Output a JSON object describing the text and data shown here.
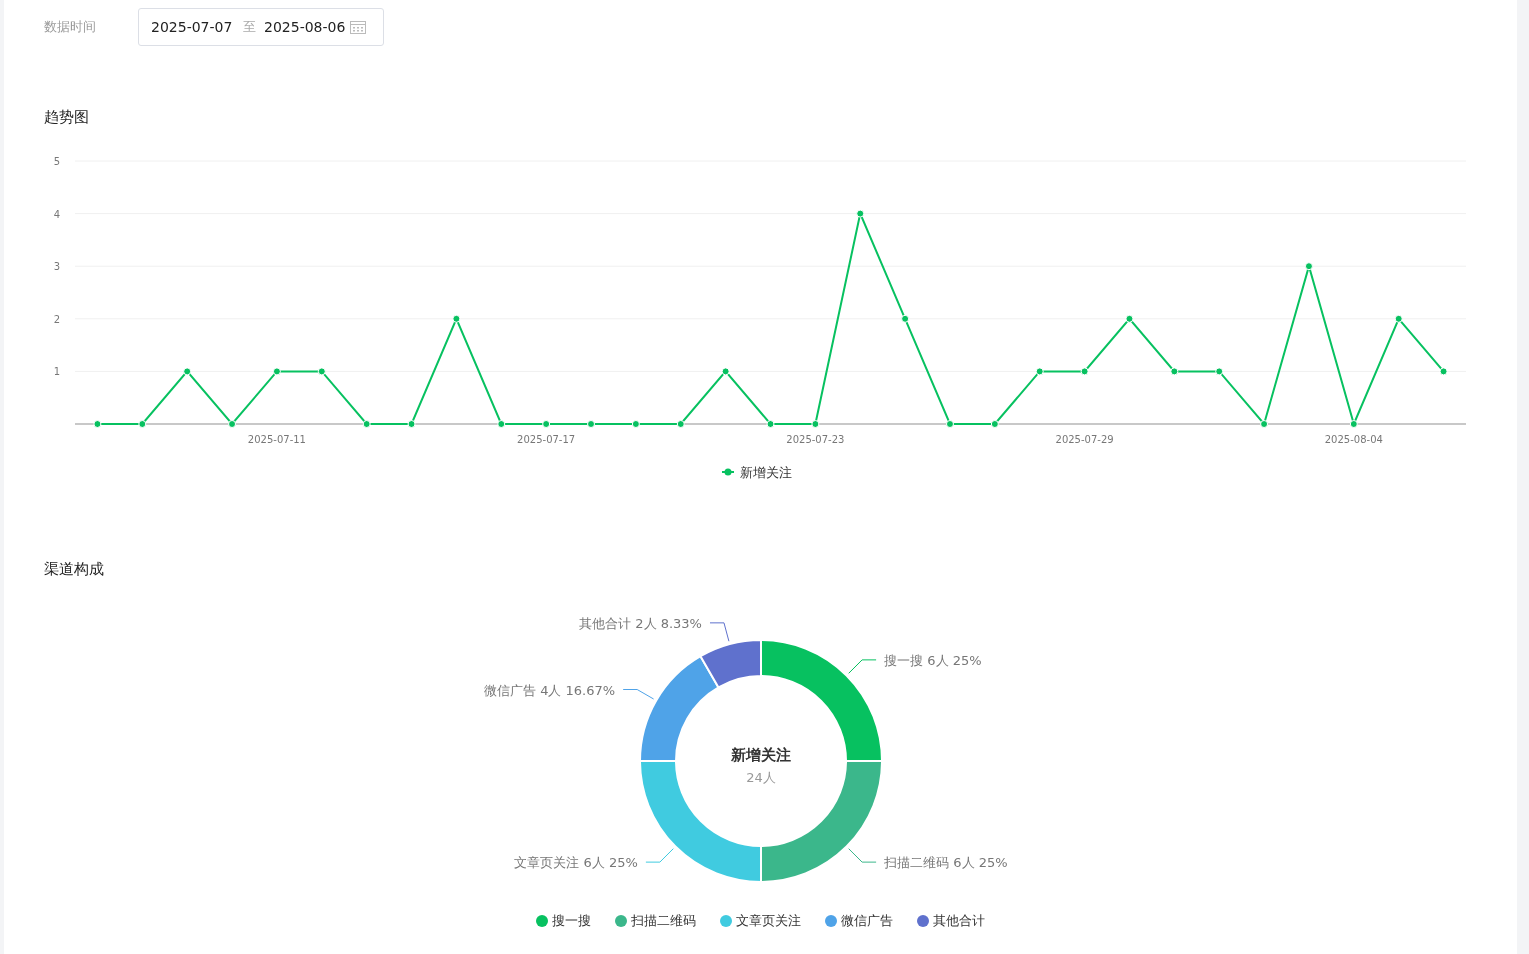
{
  "filter": {
    "label": "数据时间",
    "start": "2025-07-07",
    "separator": "至",
    "end": "2025-08-06"
  },
  "trend": {
    "title": "趋势图",
    "chart_data": {
      "type": "line",
      "categories": [
        null,
        null,
        null,
        null,
        "2025-07-11",
        null,
        null,
        null,
        null,
        null,
        "2025-07-17",
        null,
        null,
        null,
        null,
        null,
        "2025-07-23",
        null,
        null,
        null,
        null,
        null,
        "2025-07-29",
        null,
        null,
        null,
        null,
        null,
        "2025-08-04",
        null,
        null
      ],
      "grid": true,
      "series": [
        {
          "name": "新增关注",
          "color": "#07c160",
          "marker": true,
          "values": [
            0,
            0,
            1,
            0,
            1,
            1,
            0,
            0,
            2,
            0,
            0,
            0,
            0,
            0,
            1,
            0,
            0,
            4,
            2,
            0,
            0,
            1,
            1,
            2,
            1,
            1,
            0,
            3,
            0,
            2,
            1
          ]
        }
      ],
      "ylim": [
        0,
        5
      ],
      "yticks": [
        {
          "value": 1,
          "label": "1"
        },
        {
          "value": 2,
          "label": "2"
        },
        {
          "value": 3,
          "label": "3"
        },
        {
          "value": 4,
          "label": "4"
        },
        {
          "value": 5,
          "label": "5"
        }
      ]
    }
  },
  "channels": {
    "title": "渠道构成",
    "chart_data": {
      "type": "donut",
      "categories": [
        "搜一搜",
        "扫描二维码",
        "文章页关注",
        "微信广告",
        "其他合计"
      ],
      "values": [
        6,
        6,
        6,
        4,
        2
      ],
      "value_labels": [
        "搜一搜 6人 25%",
        "扫描二维码 6人 25%",
        "文章页关注 6人 25%",
        "微信广告 4人 16.67%",
        "其他合计 2人 8.33%"
      ],
      "annotations": [
        {
          "text": "新增关注"
        },
        {
          "text": "24人"
        }
      ]
    },
    "legend": [
      {
        "color": "#07c160"
      },
      {
        "color": "#3bb78b"
      },
      {
        "color": "#40cbe0"
      },
      {
        "color": "#4fa3e8"
      },
      {
        "color": "#5f71cd"
      }
    ]
  }
}
